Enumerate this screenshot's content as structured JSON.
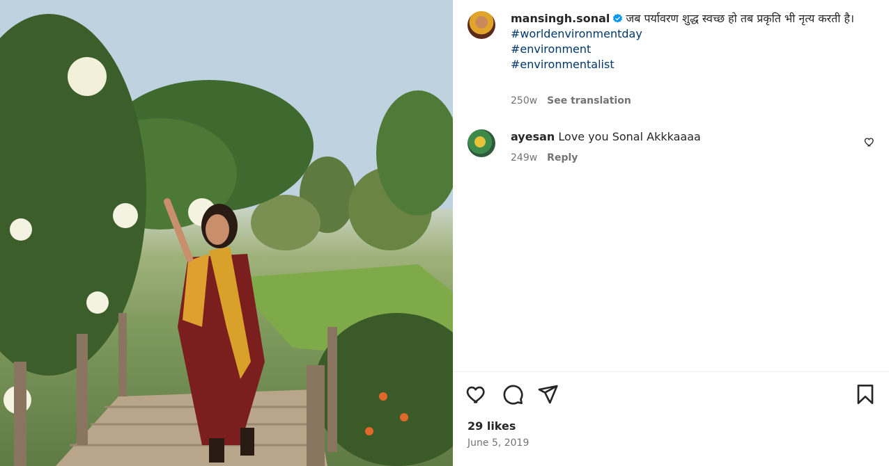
{
  "post": {
    "image_alt": "",
    "owner": {
      "username": "mansingh.sonal",
      "verified": true,
      "caption_text": "जब पर्यावरण शुद्ध स्वच्छ हो तब प्रकृति भी नृत्य करती है।",
      "hashtags": [
        "#worldenvironmentday",
        "#environment",
        "#environmentalist"
      ],
      "age": "250w",
      "translate_label": "See translation"
    },
    "comments": [
      {
        "username": "ayesan",
        "text": "Love you Sonal Akkkaaaa",
        "age": "249w",
        "reply_label": "Reply"
      }
    ],
    "likes_label": "29 likes",
    "date": "June 5, 2019"
  },
  "icons": {
    "like": "heart-icon",
    "comment": "comment-bubble-icon",
    "share": "paper-plane-icon",
    "save": "bookmark-icon",
    "verified": "verified-badge-icon",
    "comment_like": "heart-icon"
  },
  "colors": {
    "hashtag": "#00376b",
    "verified": "#0095f6",
    "text": "#262626",
    "muted": "#737373",
    "divider": "#efefef"
  }
}
